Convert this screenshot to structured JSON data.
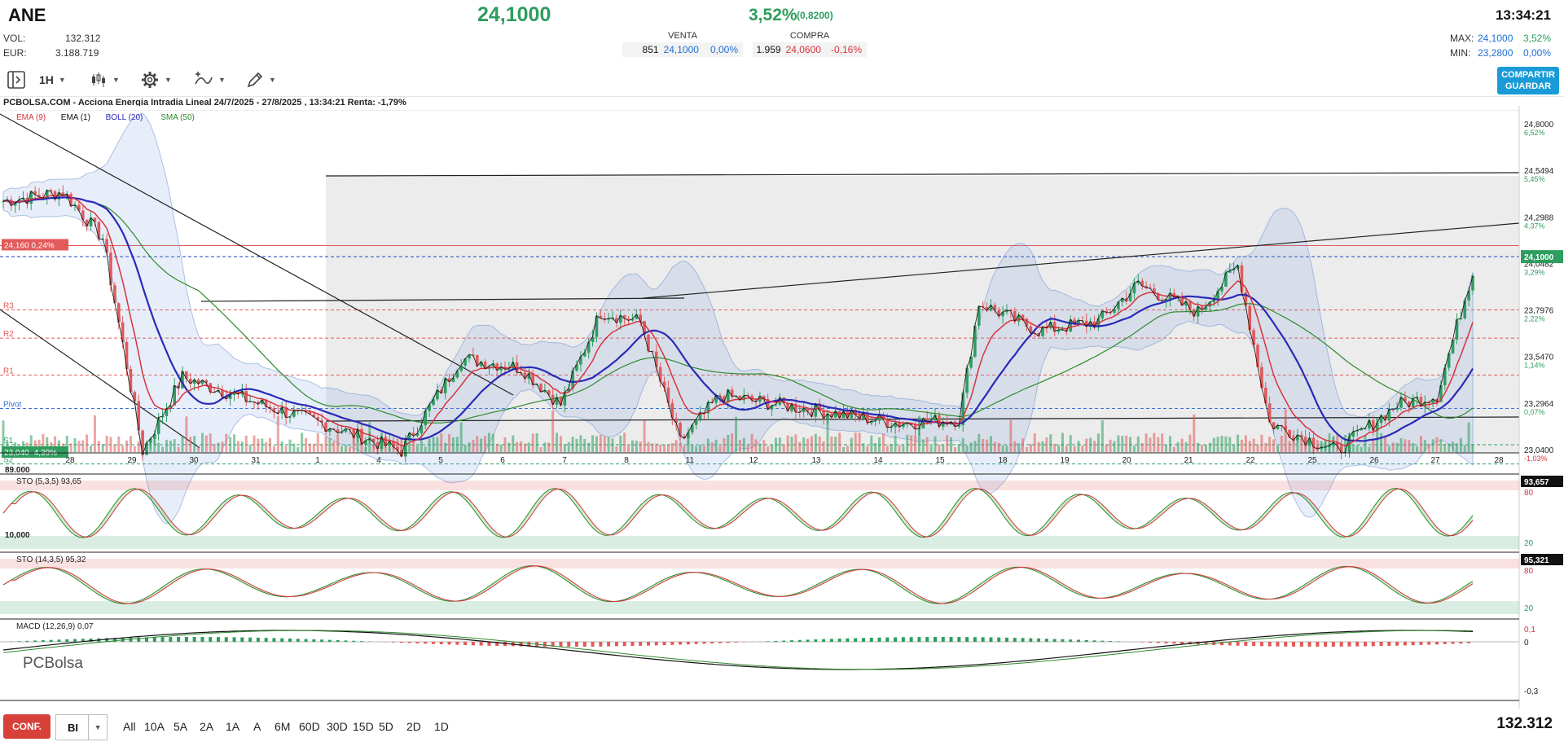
{
  "header": {
    "ticker": "ANE",
    "last_price": "24,1000",
    "change_pct": "3,52%",
    "change_abs": "(0,8200)",
    "time": "13:34:21",
    "vol_label": "VOL:",
    "vol_value": "132.312",
    "eur_label": "EUR:",
    "eur_value": "3.188.719",
    "venta_label": "VENTA",
    "venta_qty": "851",
    "venta_price": "24,1000",
    "venta_pct": "0,00%",
    "compra_label": "COMPRA",
    "compra_qty": "1.959",
    "compra_price": "24,0600",
    "compra_pct": "-0,16%",
    "max_label": "MAX:",
    "max_value": "24,1000",
    "max_pct": "3,52%",
    "min_label": "MIN:",
    "min_value": "23,2800",
    "min_pct": "0,00%"
  },
  "toolbar": {
    "interval": "1H",
    "share_line1": "COMPARTIR",
    "share_line2": "GUARDAR"
  },
  "chart": {
    "title": "PCBOLSA.COM - Acciona Energia Intradia Lineal 24/7/2025 - 27/8/2025 , 13:34:21 Renta: -1,79%",
    "legend": [
      {
        "label": "EMA (9)",
        "color": "#d8333b"
      },
      {
        "label": "EMA (1)",
        "color": "#111111"
      },
      {
        "label": "BOLL (20)",
        "color": "#2a2ab8"
      },
      {
        "label": "SMA (50)",
        "color": "#2e8b2e"
      }
    ],
    "price_axis": [
      {
        "price": "24,8000",
        "pct": "6,52%"
      },
      {
        "price": "24,5494",
        "pct": "5,45%"
      },
      {
        "price": "24,2988",
        "pct": "4,37%"
      },
      {
        "price": "24,0482",
        "pct": "3,29%"
      },
      {
        "price": "23,7976",
        "pct": "2,22%"
      },
      {
        "price": "23,5470",
        "pct": "1,14%"
      },
      {
        "price": "23,2964",
        "pct": "0,07%"
      },
      {
        "price": "23,0400",
        "pct": "-1,03%"
      }
    ],
    "current_price_label": "24,1000",
    "left_label_high": "24,160  0,24%",
    "left_label_low": "23,040  -4,39%",
    "pivot_labels": [
      "R3",
      "R2",
      "R1",
      "Pivot",
      "S1",
      "S2"
    ],
    "x_labels": [
      "28",
      "29",
      "30",
      "31",
      "1",
      "4",
      "5",
      "6",
      "7",
      "8",
      "11",
      "12",
      "13",
      "14",
      "15",
      "18",
      "19",
      "20",
      "21",
      "22",
      "25",
      "26",
      "27",
      "28"
    ],
    "volume_label": "89.000",
    "volume_label_low": "10,000"
  },
  "sto1": {
    "label": "STO (5,3,5)",
    "value": "93,65",
    "axis_value": "93,657",
    "lvl_hi": "80",
    "lvl_lo": "20"
  },
  "sto2": {
    "label": "STO (14,3,5)",
    "value": "95,32",
    "axis_value": "95,321",
    "lvl_hi": "80",
    "lvl_lo": "20"
  },
  "macd": {
    "label": "MACD (12,26,9)",
    "value": "0,07",
    "axis_top": "0,1",
    "axis_mid": "0",
    "axis_bot": "-0,3"
  },
  "logo": "PCBolsa",
  "bottom": {
    "config": "CONF.",
    "mode": "BI",
    "ranges": [
      "All",
      "10A",
      "5A",
      "2A",
      "1A",
      "A",
      "6M",
      "60D",
      "30D",
      "15D",
      "5D",
      "2D",
      "1D"
    ],
    "volume_total": "132.312"
  },
  "colors": {
    "up": "#2e9d5e",
    "down": "#e25a5a",
    "accent": "#1a9bd7",
    "config": "#d8403a"
  }
}
